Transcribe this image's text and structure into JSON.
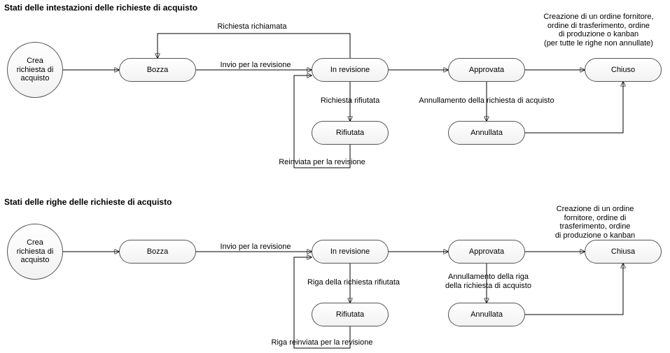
{
  "diagram1": {
    "title": "Stati delle intestazioni delle richieste di acquisto",
    "start": "Crea richiesta di acquisto",
    "nodes": {
      "bozza": "Bozza",
      "in_revisione": "In revisione",
      "approvata": "Approvata",
      "chiuso": "Chiuso",
      "rifiutata": "Rifiutata",
      "annullata": "Annullata"
    },
    "edges": {
      "richiesta_richiamata": "Richiesta richiamata",
      "invio_revisione": "Invio per la revisione",
      "richiesta_rifiutata": "Richiesta rifiutata",
      "reinviata_revisione": "Reinviata per la revisione",
      "annullamento": "Annullamento della richiesta di acquisto",
      "creazione_ordine": "Creazione di un ordine fornitore,\nordine di trasferimento, ordine\ndi produzione o kanban\n(per tutte le righe non annullate)"
    }
  },
  "diagram2": {
    "title": "Stati delle righe delle richieste di acquisto",
    "start": "Crea richiesta di acquisto",
    "nodes": {
      "bozza": "Bozza",
      "in_revisione": "In revisione",
      "approvata": "Approvata",
      "chiusa": "Chiusa",
      "rifiutata": "Rifiutata",
      "annullata": "Annullata"
    },
    "edges": {
      "invio_revisione": "Invio per la revisione",
      "riga_rifiutata": "Riga della richiesta rifiutata",
      "riga_reinviata": "Riga reinviata per la revisione",
      "annullamento_riga": "Annullamento della riga\ndella richiesta di acquisto",
      "creazione_ordine": "Creazione di un ordine\nfornitore, ordine di\ntrasferimento, ordine\ndi produzione o kanban"
    }
  }
}
